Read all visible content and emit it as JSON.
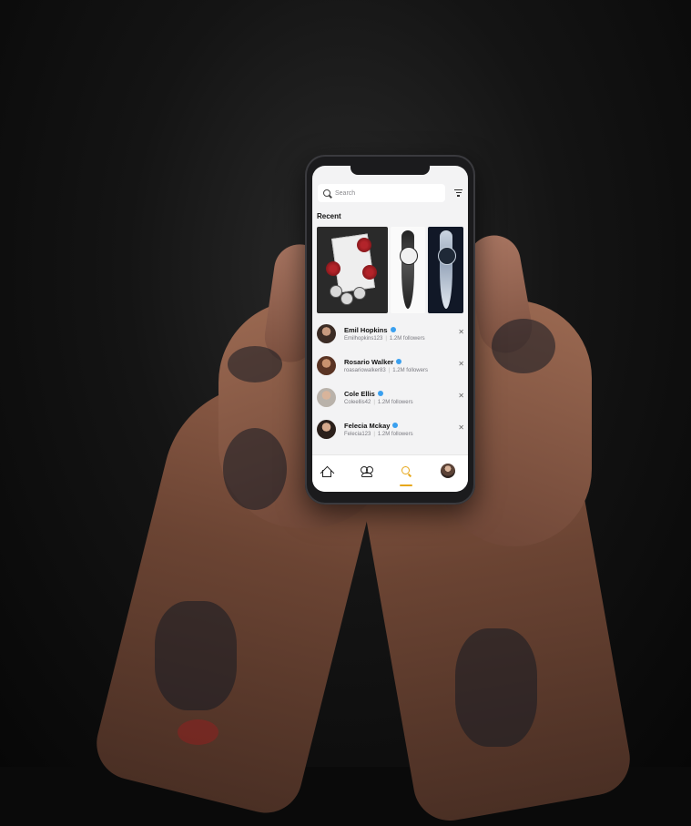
{
  "search": {
    "placeholder": "Search"
  },
  "recent": {
    "title": "Recent",
    "images": [
      {
        "icon": "tattoo-card-roses-image"
      },
      {
        "icon": "tattoo-dagger-face-image"
      },
      {
        "icon": "tattoo-dagger-face-dark-image"
      }
    ]
  },
  "users": [
    {
      "name": "Emil Hopkins",
      "handle": "Emilhopkins123",
      "followers": "1.2M followers",
      "avatar_color": "#3b2c25"
    },
    {
      "name": "Rosario Walker",
      "handle": "roasariowalker83",
      "followers": "1.2M followers",
      "avatar_color": "#5a3424"
    },
    {
      "name": "Cole Ellis",
      "handle": "Coleellis42",
      "followers": "1.2M followers",
      "avatar_color": "#b9b2aa"
    },
    {
      "name": "Felecia Mckay",
      "handle": "Felecia123",
      "followers": "1.2M followers",
      "avatar_color": "#2b201b"
    }
  ],
  "nav": {
    "items": [
      "home-icon",
      "friends-icon",
      "search-icon",
      "profile-avatar"
    ],
    "active": "search-icon",
    "accent_color": "#e7a71a"
  },
  "colors": {
    "verified": "#3aa0ef",
    "screen_bg": "#f3f3f4"
  }
}
